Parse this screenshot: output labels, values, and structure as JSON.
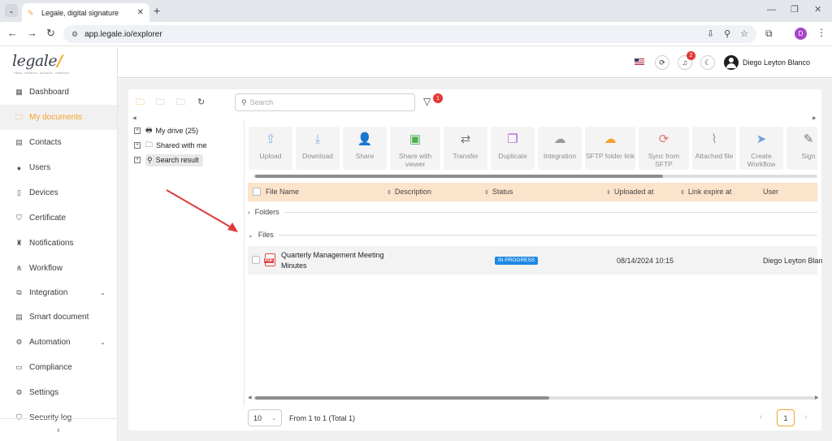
{
  "browser": {
    "tab_title": "Legale, digital signature",
    "url": "app.legale.io/explorer",
    "profile_initial": "D"
  },
  "logo": {
    "text": "legale",
    "subtitle": "FIRMA · APPROVA · ARCHIVIA · CONDIVIDI"
  },
  "header": {
    "notification_count": "2",
    "user_name": "Diego Leyton Blanco"
  },
  "sidebar": {
    "items": [
      {
        "label": "Dashboard",
        "icon": "dashboard-icon",
        "glyph": "▦"
      },
      {
        "label": "My documents",
        "icon": "folder-icon",
        "glyph": "🗀"
      },
      {
        "label": "Contacts",
        "icon": "contacts-icon",
        "glyph": "▤"
      },
      {
        "label": "Users",
        "icon": "user-icon",
        "glyph": "●"
      },
      {
        "label": "Devices",
        "icon": "device-icon",
        "glyph": "▯"
      },
      {
        "label": "Certificate",
        "icon": "shield-icon",
        "glyph": "⛉"
      },
      {
        "label": "Notifications",
        "icon": "bell-icon",
        "glyph": "♜"
      },
      {
        "label": "Workflow",
        "icon": "workflow-icon",
        "glyph": "⋔"
      },
      {
        "label": "Integration",
        "icon": "integration-icon",
        "glyph": "⧉"
      },
      {
        "label": "Smart document",
        "icon": "smart-document-icon",
        "glyph": "▤"
      },
      {
        "label": "Automation",
        "icon": "automation-icon",
        "glyph": "⚙"
      },
      {
        "label": "Compliance",
        "icon": "compliance-icon",
        "glyph": "▭"
      },
      {
        "label": "Settings",
        "icon": "gear-icon",
        "glyph": "⚙"
      },
      {
        "label": "Security log",
        "icon": "shield-icon",
        "glyph": "⛉"
      }
    ]
  },
  "search": {
    "placeholder": "Search"
  },
  "filter": {
    "badge_count": "1"
  },
  "tree": {
    "items": [
      {
        "label": "My drive (25)",
        "icon": "drive-icon"
      },
      {
        "label": "Shared with me",
        "icon": "folder-icon"
      },
      {
        "label": "Search result",
        "icon": "search-icon"
      }
    ]
  },
  "actions": [
    {
      "label": "Upload",
      "icon": "upload-icon",
      "glyph": "⇪",
      "color": "#7fb2e6"
    },
    {
      "label": "Download",
      "icon": "download-icon",
      "glyph": "⤓",
      "color": "#7fb2e6"
    },
    {
      "label": "Share",
      "icon": "add-user-icon",
      "glyph": "👤",
      "color": "#6ea0d6"
    },
    {
      "label": "Share with viewer",
      "icon": "share-viewer-icon",
      "glyph": "▣",
      "color": "#4caf50"
    },
    {
      "label": "Transfer",
      "icon": "transfer-icon",
      "glyph": "⇄",
      "color": "#777777"
    },
    {
      "label": "Duplicate",
      "icon": "duplicate-icon",
      "glyph": "❐",
      "color": "#b05bd6"
    },
    {
      "label": "Integration",
      "icon": "cloud-icon",
      "glyph": "☁",
      "color": "#999999"
    },
    {
      "label": "SFTP folder link",
      "icon": "sftp-icon",
      "glyph": "☁",
      "color": "#f3a327"
    },
    {
      "label": "Sync from SFTP",
      "icon": "sync-icon",
      "glyph": "⟳",
      "color": "#e57373"
    },
    {
      "label": "Attached file",
      "icon": "paperclip-icon",
      "glyph": "⌇",
      "color": "#999999"
    },
    {
      "label": "Create Workflow",
      "icon": "send-icon",
      "glyph": "➤",
      "color": "#6ea0d6"
    },
    {
      "label": "Sign",
      "icon": "sign-icon",
      "glyph": "✎",
      "color": "#777777"
    }
  ],
  "table": {
    "headers": {
      "file_name": "File Name",
      "description": "Description",
      "status": "Status",
      "uploaded_at": "Uploaded at",
      "link_expire_at": "Link expire at",
      "user": "User"
    },
    "groups": {
      "folders": "Folders",
      "files": "Files"
    },
    "rows": [
      {
        "file_name": "Quarterly Management Meeting Minutes",
        "status": "IN PROGRESS",
        "uploaded_at": "08/14/2024 10:15",
        "user": "Diego Leyton Blan"
      }
    ]
  },
  "pagination": {
    "page_size": "10",
    "info": "From 1 to 1 (Total 1)",
    "current_page": "1"
  },
  "colors": {
    "accent": "#f3a327",
    "header_row": "#fbe3cc",
    "badge_blue": "#1e88e5",
    "annotation": "#e03a3a"
  }
}
